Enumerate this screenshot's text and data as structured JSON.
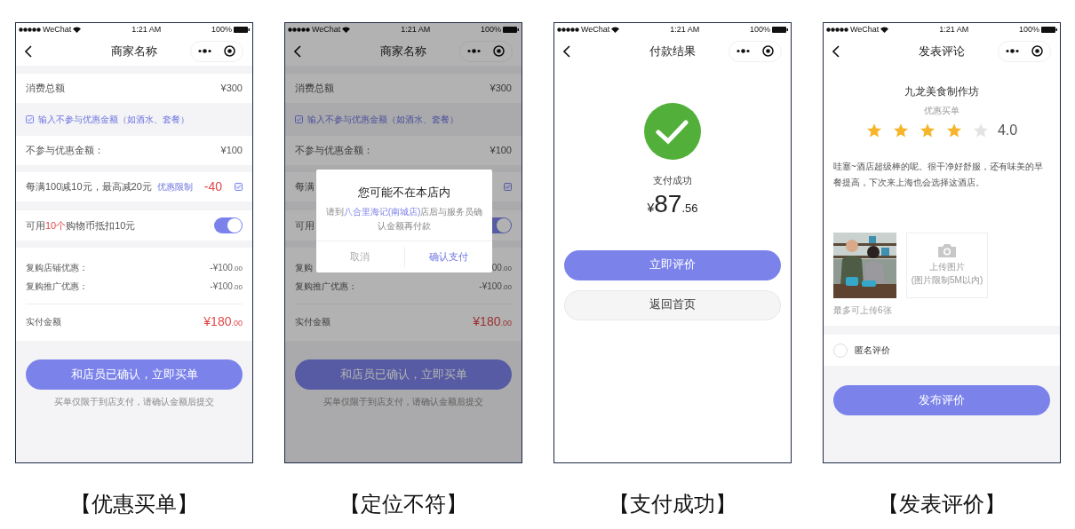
{
  "screens": [
    {
      "kind": "order",
      "status_bar": {
        "carrier": "WeChat",
        "time": "1:21 AM",
        "battery": "100%"
      },
      "nav": {
        "title": "商家名称"
      },
      "total": {
        "label": "消费总额",
        "value": "¥300"
      },
      "exclude_option": {
        "label": "输入不参与优惠金额（如酒水、套餐）",
        "checked": true
      },
      "excluded": {
        "label": "不参与优惠金额：",
        "value": "¥100"
      },
      "discount": {
        "text": "每满100减10元，最高减20元",
        "tag": "优惠限制",
        "amount": "-40",
        "checked": true
      },
      "coins": {
        "prefix": "可用",
        "highlight": "10个",
        "suffix": "购物币抵扣10元",
        "on": true
      },
      "deductions": [
        {
          "label": "复购店铺优惠：",
          "value": "-¥100",
          "cents": ".00"
        },
        {
          "label": "复购推广优惠：",
          "value": "-¥100",
          "cents": ".00"
        }
      ],
      "pay": {
        "label": "实付金额",
        "value": "¥180",
        "cents": ".00"
      },
      "button": "和店员已确认，立即买单",
      "note": "买单仅限于到店支付，请确认金额后提交",
      "caption": "【优惠买单】"
    },
    {
      "kind": "order",
      "status_bar": {
        "carrier": "WeChat",
        "time": "1:21 AM",
        "battery": "100%"
      },
      "nav": {
        "title": "商家名称"
      },
      "total": {
        "label": "消费总额",
        "value": "¥300"
      },
      "exclude_option": {
        "label": "输入不参与优惠金额（如酒水、套餐）",
        "checked": true
      },
      "excluded": {
        "label": "不参与优惠金额：",
        "value": "¥100"
      },
      "discount": {
        "text": "每满",
        "checked": true
      },
      "coins": {
        "prefix": "可用",
        "on": true
      },
      "deductions": [
        {
          "label": "复购",
          "value": "00",
          "cents": ".00"
        },
        {
          "label": "复购推广优惠：",
          "value": "-¥100",
          "cents": ".00"
        }
      ],
      "pay": {
        "label": "实付金额",
        "value": "¥180",
        "cents": ".00"
      },
      "button": "和店员已确认，立即买单",
      "note": "买单仅限于到店支付，请确认金额后提交",
      "dialog": {
        "title": "您可能不在本店内",
        "message_start": "请到",
        "store": "八合里海记(南城店)",
        "message_end": "店后与服务员确认金额再付款",
        "cancel": "取消",
        "confirm": "确认支付"
      },
      "caption": "【定位不符】"
    },
    {
      "kind": "success",
      "status_bar": {
        "carrier": "WeChat",
        "time": "1:21 AM",
        "battery": "100%"
      },
      "nav": {
        "title": "付款结果"
      },
      "status": "支付成功",
      "currency": "¥",
      "amount": "87",
      "cents": ".56",
      "primary": "立即评价",
      "secondary": "返回首页",
      "caption": "【支付成功】"
    },
    {
      "kind": "review",
      "status_bar": {
        "carrier": "WeChat",
        "time": "1:21 AM",
        "battery": "100%"
      },
      "nav": {
        "title": "发表评论"
      },
      "store": "九龙美食制作坊",
      "tag": "优惠买单",
      "rating": {
        "stars": 4,
        "score": "4.0"
      },
      "review": "哇塞~酒店超级棒的呢。很干净好舒服，还有味美的早餐提高，下次来上海也会选择这酒店。",
      "upload": {
        "label": "上传图片",
        "hint": "(图片限制5M以内)",
        "limit": "最多可上传6张"
      },
      "anonymous": {
        "label": "匿名评价",
        "checked": false
      },
      "button": "发布评价",
      "caption": "【发表评价】"
    }
  ]
}
